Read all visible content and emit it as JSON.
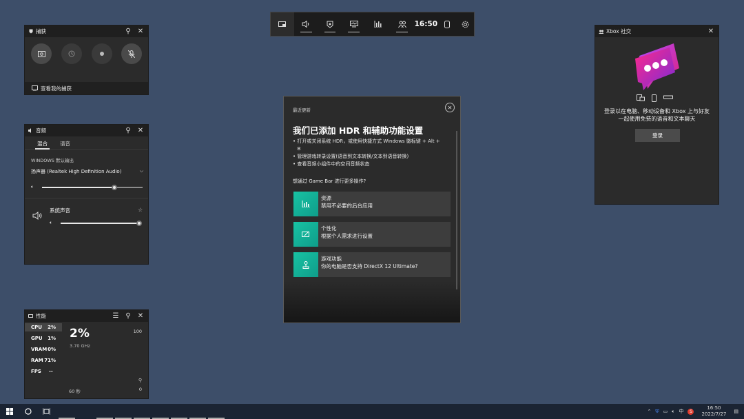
{
  "toolbar": {
    "clock": "16:50"
  },
  "capture": {
    "title": "捕获",
    "see_captures": "查看我的捕获"
  },
  "audio": {
    "title": "音频",
    "tabs": [
      "混合",
      "语音"
    ],
    "output_label": "WINDOWS 默认输出",
    "device": "扬声器 (Realtek High Definition Audio)",
    "master_volume_pct": 72,
    "system_sound_label": "系统声音",
    "system_volume_pct": 100
  },
  "performance": {
    "title": "性能",
    "rows": [
      {
        "label": "CPU",
        "value": "2%"
      },
      {
        "label": "GPU",
        "value": "1%"
      },
      {
        "label": "VRAM",
        "value": "0%"
      },
      {
        "label": "RAM",
        "value": "71%"
      },
      {
        "label": "FPS",
        "value": "--"
      }
    ],
    "big_value": "2%",
    "freq": "3.70 GHz",
    "max": "100",
    "min": "0",
    "duration": "60 秒"
  },
  "social": {
    "title": "Xbox 社交",
    "message_line1": "登录以在电脑、移动设备和 Xbox 上与好友",
    "message_line2": "一起使用免费的语音和文本聊天",
    "login_button": "登录"
  },
  "dialog": {
    "header": "最近更新",
    "title": "我们已添加 HDR 和辅助功能设置",
    "bullets": [
      "• 打开或关闭系统 HDR，或使用快捷方式 Windows 徽标键 + Alt +",
      "   B",
      "• 管理游戏转录设置(语音到文本转换/文本到语音转换)",
      "• 查看音频小组件中的空间音频状态"
    ],
    "question": "想通过 Game Bar 进行更多操作?",
    "cards": [
      {
        "title": "资源",
        "subtitle": "禁用不必要的后台应用"
      },
      {
        "title": "个性化",
        "subtitle": "根据个人需求进行设置"
      },
      {
        "title": "游戏功能",
        "subtitle": "你的电脑是否支持 DirectX 12 Ultimate?"
      }
    ]
  },
  "taskbar": {
    "tray_ime": "中",
    "time": "16:50",
    "date": "2022/7/27"
  },
  "colors": {
    "accent_teal": "#18c2a3",
    "background": "#3d4e69",
    "xbox_pink": "#e0207a"
  }
}
